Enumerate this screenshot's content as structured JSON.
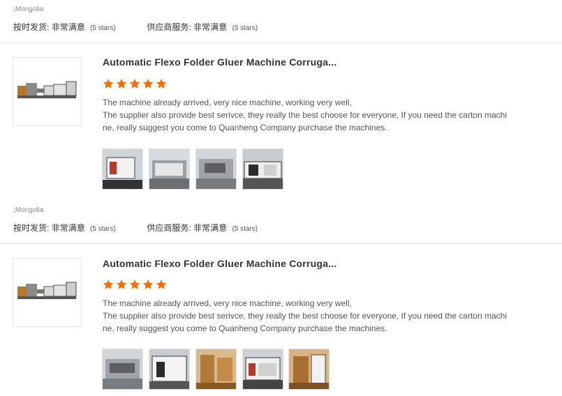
{
  "reviews": [
    {
      "country": ",Mongolia",
      "ship_label": "按时发货:",
      "ship_value": "非常满意",
      "ship_stars": "(5 stars)",
      "supplier_label": "供应商服务:",
      "supplier_value": "非常满意",
      "supplier_stars": "(5 stars)",
      "product_title": "Automatic Flexo Folder Gluer Machine Corruga...",
      "rating": 5,
      "review_lines": [
        "The machine already arrived, very nice machine, working very well,",
        "The supplier also provide best serivce, they really the best choose for everyone, If you need the carton machi",
        "ne, really suggest you come to Quanheng Company purchase the machines."
      ],
      "photo_count": 4
    },
    {
      "country": ",Mongolia",
      "ship_label": "按时发货:",
      "ship_value": "非常满意",
      "ship_stars": "(5 stars)",
      "supplier_label": "供应商服务:",
      "supplier_value": "非常满意",
      "supplier_stars": "(5 stars)",
      "product_title": "Automatic Flexo Folder Gluer Machine Corruga...",
      "rating": 5,
      "review_lines": [
        "The machine already arrived, very nice machine, working very well,",
        "The supplier also provide best serivce, they really the best choose for everyone, If you need the carton machi",
        "ne, really suggest you come to Quanheng Company purchase the machines."
      ],
      "photo_count": 5
    }
  ],
  "colors": {
    "star": "#ff6a00",
    "divider": "#e6e6e6"
  },
  "icons": {
    "star": "star-icon"
  }
}
